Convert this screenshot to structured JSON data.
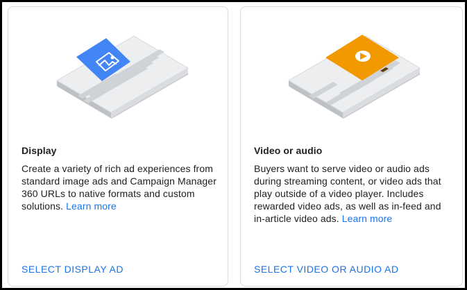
{
  "cards": [
    {
      "title": "Display",
      "description": "Create a variety of rich ad experiences from standard image ads and Campaign Manager 360 URLs to native formats and custom solutions.",
      "link_label": "Learn more",
      "action_label": "SELECT DISPLAY AD",
      "illustration_icon": "image-icon",
      "accent_color": "#4285f4"
    },
    {
      "title": "Video or audio",
      "description": "Buyers want to serve video or audio ads during streaming content, or video ads that play outside of a video player. Includes rewarded video ads, as well as in-feed and in-article video ads.",
      "link_label": "Learn more",
      "action_label": "SELECT VIDEO OR AUDIO AD",
      "illustration_icon": "play-icon",
      "accent_color": "#f29900"
    }
  ]
}
